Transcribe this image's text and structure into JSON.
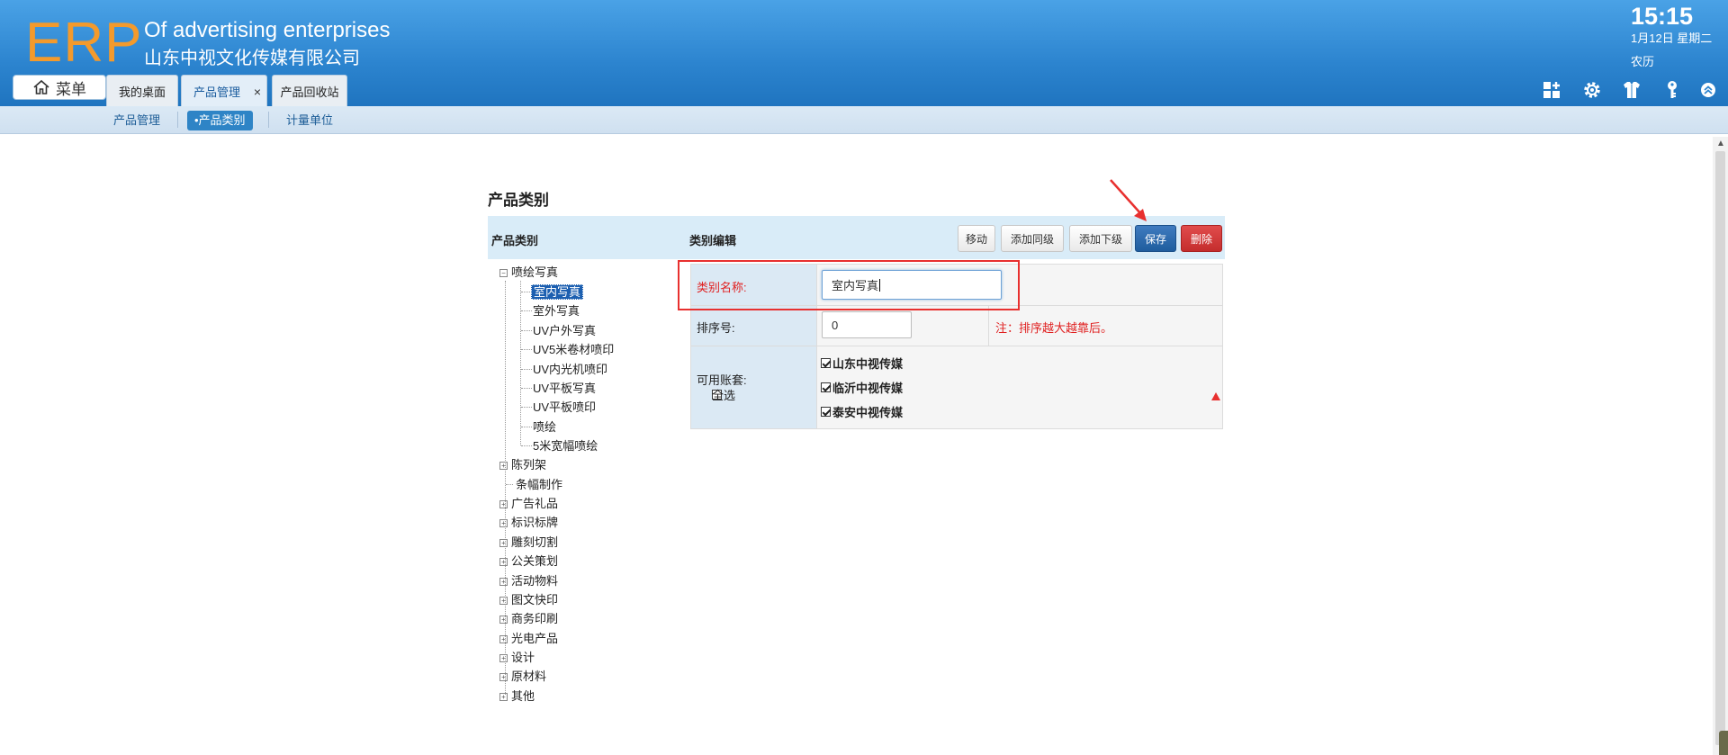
{
  "header": {
    "logo": "ERP",
    "brand_en": "Of advertising enterprises",
    "brand_cn": "山东中视文化传媒有限公司",
    "time": "15:15",
    "date": "1月12日 星期二",
    "lunar": "农历",
    "menu_label": "菜单",
    "tabs": [
      {
        "label": "我的桌面"
      },
      {
        "label": "产品管理",
        "close": "×"
      },
      {
        "label": "产品回收站"
      }
    ],
    "icons": [
      "grid-add-icon",
      "gear-icon",
      "shirt-icon",
      "key-icon",
      "collapse-up-icon"
    ]
  },
  "subnav": {
    "items": [
      {
        "label": "产品管理"
      },
      {
        "label": "•产品类别"
      },
      {
        "label": "计量单位"
      }
    ]
  },
  "page": {
    "title": "产品类别",
    "left_heading": "产品类别",
    "right_heading": "类别编辑",
    "buttons": {
      "move": "移动",
      "add_sibling": "添加同级",
      "add_child": "添加下级",
      "save": "保存",
      "delete": "删除"
    }
  },
  "tree": {
    "root_expanded": {
      "label": "喷绘写真",
      "toggle": "−"
    },
    "children": [
      {
        "label": "室内写真",
        "selected": true
      },
      {
        "label": "室外写真"
      },
      {
        "label": "UV户外写真"
      },
      {
        "label": "UV5米卷材喷印"
      },
      {
        "label": "UV内光机喷印"
      },
      {
        "label": "UV平板写真"
      },
      {
        "label": "UV平板喷印"
      },
      {
        "label": "喷绘"
      },
      {
        "label": "5米宽幅喷绘"
      }
    ],
    "others": [
      {
        "label": "陈列架",
        "toggle": "+"
      },
      {
        "label": "条幅制作",
        "toggle": ""
      },
      {
        "label": "广告礼品",
        "toggle": "+"
      },
      {
        "label": "标识标牌",
        "toggle": "+"
      },
      {
        "label": "雕刻切割",
        "toggle": "+"
      },
      {
        "label": "公关策划",
        "toggle": "+"
      },
      {
        "label": "活动物料",
        "toggle": "+"
      },
      {
        "label": "图文快印",
        "toggle": "+"
      },
      {
        "label": "商务印刷",
        "toggle": "+"
      },
      {
        "label": "光电产品",
        "toggle": "+"
      },
      {
        "label": "设计",
        "toggle": "+"
      },
      {
        "label": "原材料",
        "toggle": "+"
      },
      {
        "label": "其他",
        "toggle": "+"
      }
    ]
  },
  "form": {
    "name_label": "类别名称:",
    "name_value": "室内写真",
    "sort_label": "排序号:",
    "sort_value": "0",
    "sort_note": "注：排序越大越靠后。",
    "accounts_label": "可用账套:",
    "select_all": "全选",
    "accounts": [
      {
        "label": "山东中视传媒",
        "checked": true
      },
      {
        "label": "临沂中视传媒",
        "checked": true
      },
      {
        "label": "泰安中视传媒",
        "checked": true
      }
    ]
  }
}
